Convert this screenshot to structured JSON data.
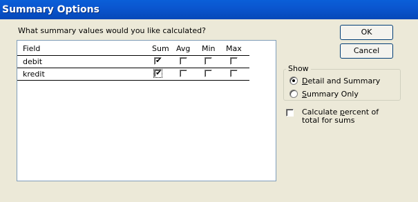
{
  "window": {
    "title": "Summary Options"
  },
  "prompt": "What summary values would you like calculated?",
  "grid": {
    "columns": [
      "Field",
      "Sum",
      "Avg",
      "Min",
      "Max"
    ],
    "rows": [
      {
        "field": "debit",
        "sum": true,
        "avg": false,
        "min": false,
        "max": false
      },
      {
        "field": "kredit",
        "sum": true,
        "avg": false,
        "min": false,
        "max": false
      }
    ]
  },
  "buttons": {
    "ok": "OK",
    "cancel": "Cancel"
  },
  "show_group": {
    "label": "Show",
    "options": [
      {
        "accel": "D",
        "rest": "etail and Summary",
        "selected": true
      },
      {
        "accel": "S",
        "rest": "ummary Only",
        "selected": false
      }
    ]
  },
  "percent": {
    "line1_pre": "Calculate ",
    "line1_accel": "p",
    "line1_post": "ercent of",
    "line2": "total for sums",
    "checked": false
  },
  "colors": {
    "titlebar": "#0a56d0",
    "face": "#ece9d8"
  }
}
